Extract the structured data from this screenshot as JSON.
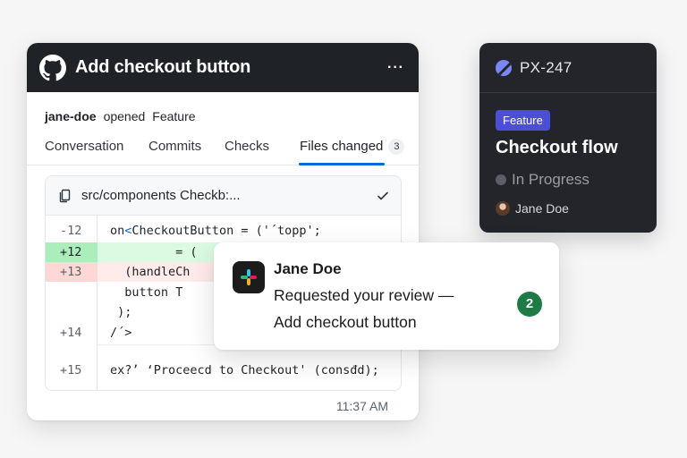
{
  "pr_card": {
    "logo_icon": "github-icon",
    "title": "Add checkout button",
    "more_icon": "···",
    "author": "jane-doe",
    "action": "opened",
    "label": "Feature",
    "tabs": [
      {
        "label": "Conversation"
      },
      {
        "label": "Commits"
      },
      {
        "label": "Checks"
      },
      {
        "label": "Files changed",
        "count": "3",
        "active": true
      }
    ],
    "file": {
      "icon": "file-diff-icon",
      "name": "src/components Checkb:...",
      "reviewed_icon": "check-icon"
    },
    "diff_lines": [
      {
        "num": "-12",
        "code_pre": "on",
        "code_kw": "<",
        "code_post": "CheckoutButton = ('´topp';",
        "type": "context"
      },
      {
        "num": "+12",
        "code_pre": "         = (",
        "code_kw": "",
        "code_post": "",
        "type": "add"
      },
      {
        "num": "+13",
        "code_pre": "  (handleCh",
        "code_kw": "",
        "code_post": "",
        "type": "del"
      },
      {
        "num": "",
        "code_pre": "  button T",
        "code_kw": "",
        "code_post": "",
        "type": "context"
      },
      {
        "num": "",
        "code_pre": " );",
        "code_kw": "",
        "code_post": "",
        "type": "context"
      },
      {
        "num": "+14",
        "code_pre": "/´>",
        "code_kw": "",
        "code_post": "",
        "type": "context"
      },
      {
        "num": "+15",
        "code_pre": "ex?ʼ ‘Proceecd to Checkout' (consđd);",
        "code_kw": "",
        "code_post": "",
        "type": "context"
      }
    ],
    "timestamp": "11:37 AM"
  },
  "issue_card": {
    "icon": "linear-icon",
    "id": "PX-247",
    "badge": "Feature",
    "title": "Checkout flow",
    "status": "In Progress",
    "assignee": "Jane Doe"
  },
  "notification": {
    "app_icon": "slack-icon",
    "sender": "Jane Doe",
    "line1": "Requested your review —",
    "line2": "Add checkout button",
    "count": "2"
  },
  "colors": {
    "header_dark": "#1f2328",
    "tab_accent": "#0969da",
    "add_bg": "#dafbe1",
    "del_bg": "#ffebe9",
    "issue_bg": "#23252b",
    "badge_purple": "#4c4fd6",
    "count_green": "#1e7b46"
  }
}
